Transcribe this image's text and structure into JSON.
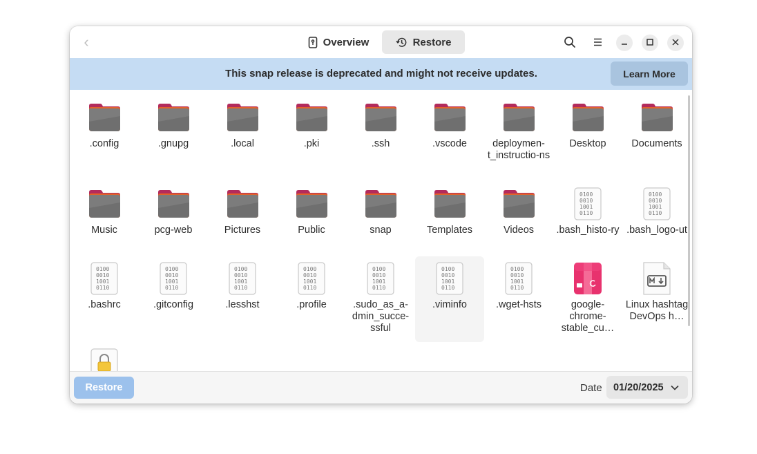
{
  "headerbar": {
    "tabs": [
      {
        "label": "Overview",
        "icon": "phone-backup-icon",
        "active": false
      },
      {
        "label": "Restore",
        "icon": "history-icon",
        "active": true
      }
    ]
  },
  "banner": {
    "text": "This snap release is deprecated and might not receive updates.",
    "button_label": "Learn More"
  },
  "files": [
    {
      "name": ".config",
      "type": "folder"
    },
    {
      "name": ".gnupg",
      "type": "folder"
    },
    {
      "name": ".local",
      "type": "folder"
    },
    {
      "name": ".pki",
      "type": "folder"
    },
    {
      "name": ".ssh",
      "type": "folder"
    },
    {
      "name": ".vscode",
      "type": "folder"
    },
    {
      "name": "deploymen-t_instructio-ns",
      "type": "folder"
    },
    {
      "name": "Desktop",
      "type": "folder"
    },
    {
      "name": "Documents",
      "type": "folder"
    },
    {
      "name": "Music",
      "type": "folder"
    },
    {
      "name": "pcg-web",
      "type": "folder"
    },
    {
      "name": "Pictures",
      "type": "folder"
    },
    {
      "name": "Public",
      "type": "folder"
    },
    {
      "name": "snap",
      "type": "folder"
    },
    {
      "name": "Templates",
      "type": "folder"
    },
    {
      "name": "Videos",
      "type": "folder"
    },
    {
      "name": ".bash_histo-ry",
      "type": "binary"
    },
    {
      "name": ".bash_logo-ut",
      "type": "binary"
    },
    {
      "name": ".bashrc",
      "type": "binary"
    },
    {
      "name": ".gitconfig",
      "type": "binary"
    },
    {
      "name": ".lesshst",
      "type": "binary"
    },
    {
      "name": ".profile",
      "type": "binary"
    },
    {
      "name": ".sudo_as_a-dmin_succe-ssful",
      "type": "binary"
    },
    {
      "name": ".viminfo",
      "type": "binary",
      "selected": true
    },
    {
      "name": ".wget-hsts",
      "type": "binary"
    },
    {
      "name": "google-chrome-stable_cu…",
      "type": "deb"
    },
    {
      "name": "Linux hashtag DevOps h…",
      "type": "markdown"
    },
    {
      "name": "",
      "type": "pgp",
      "icon_text": "pgp"
    }
  ],
  "footer": {
    "restore_label": "Restore",
    "date_label": "Date",
    "date_value": "01/20/2025"
  },
  "colors": {
    "banner_bg": "#c5dcf3",
    "restore_button": "#9cc1ec",
    "folder_tab": "#b32b5c",
    "folder_body": "#6e6e6e"
  }
}
